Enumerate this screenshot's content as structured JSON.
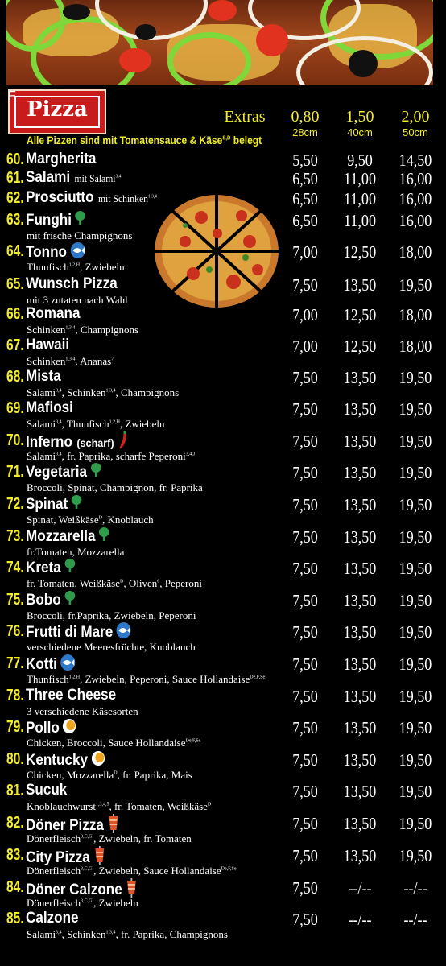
{
  "header": {
    "title": "Pizza",
    "title_sup": "F",
    "extras_label": "Extras",
    "extras": [
      "0,80",
      "1,50",
      "2,00"
    ],
    "sizes": [
      "28cm",
      "40cm",
      "50cm"
    ],
    "note": "Alle Pizzen sind mit Tomatensauce & Käse",
    "note_sup": "S,D",
    "note_end": "belegt"
  },
  "colors": {
    "accent_yellow": "#f2ec2a",
    "badge_red": "#c81c1c",
    "leaf_green": "#3aa24a"
  },
  "items": [
    {
      "num": "60.",
      "name": "Margherita",
      "extra": "",
      "extra_sup": "",
      "icon": "",
      "desc": "",
      "p": [
        "5,50",
        "9,50",
        "14,50"
      ]
    },
    {
      "num": "61.",
      "name": "Salami",
      "extra": "mit Salami",
      "extra_sup": "3,4",
      "icon": "",
      "desc": "",
      "p": [
        "6,50",
        "11,00",
        "16,00"
      ]
    },
    {
      "num": "62.",
      "name": "Prosciutto",
      "extra": "mit Schinken",
      "extra_sup": "1,3,4",
      "icon": "",
      "desc": "",
      "p": [
        "6,50",
        "11,00",
        "16,00"
      ]
    },
    {
      "num": "63.",
      "name": "Funghi",
      "extra": "",
      "extra_sup": "",
      "icon": "leaf-icon",
      "desc": "mit frische Champignons",
      "p": [
        "6,50",
        "11,00",
        "16,00"
      ]
    },
    {
      "num": "64.",
      "name": "Tonno",
      "extra": "",
      "extra_sup": "",
      "icon": "fish-icon",
      "desc": "Thunfisch<sup>1,2,H</sup>, Zwiebeln",
      "p": [
        "7,00",
        "12,50",
        "18,00"
      ]
    },
    {
      "num": "65.",
      "name": "Wunsch  Pizza",
      "extra": "",
      "extra_sup": "",
      "icon": "",
      "desc": "mit 3 zutaten nach Wahl",
      "p": [
        "7,50",
        "13,50",
        "19,50"
      ]
    },
    {
      "num": "66.",
      "name": "Romana",
      "extra": "",
      "extra_sup": "",
      "icon": "",
      "desc": "Schinken<sup>1,3,4</sup>, Champignons",
      "p": [
        "7,00",
        "12,50",
        "18,00"
      ]
    },
    {
      "num": "67.",
      "name": "Hawaii",
      "extra": "",
      "extra_sup": "",
      "icon": "",
      "desc": "Schinken<sup>1,3,4</sup>, Ananas<sup>7</sup>",
      "p": [
        "7,00",
        "12,50",
        "18,00"
      ]
    },
    {
      "num": "68.",
      "name": "Mista",
      "extra": "",
      "extra_sup": "",
      "icon": "",
      "desc": "Salami<sup>3,4</sup>, Schinken<sup>1,3,4</sup>, Champignons",
      "p": [
        "7,50",
        "13,50",
        "19,50"
      ]
    },
    {
      "num": "69.",
      "name": "Mafiosi",
      "extra": "",
      "extra_sup": "",
      "icon": "",
      "desc": "Salami<sup>3,4</sup>, Thunfisch<sup>1,2,H</sup>, Zwiebeln",
      "p": [
        "7,50",
        "13,50",
        "19,50"
      ]
    },
    {
      "num": "70.",
      "name": "Inferno",
      "extra": "(scharf)",
      "extra_sup": "",
      "icon": "chili-icon",
      "desc": "Salami<sup>3,4</sup>, fr. Paprika, scharfe Peperoni<sup>3,4,J</sup>",
      "p": [
        "7,50",
        "13,50",
        "19,50"
      ]
    },
    {
      "num": "71.",
      "name": "Vegetaria",
      "extra": "",
      "extra_sup": "",
      "icon": "leaf-icon",
      "desc": "Broccoli, Spinat, Champignon, fr. Paprika",
      "p": [
        "7,50",
        "13,50",
        "19,50"
      ]
    },
    {
      "num": "72.",
      "name": "Spinat",
      "extra": "",
      "extra_sup": "",
      "icon": "leaf-icon",
      "desc": "Spinat, Weißkäse<sup>D</sup>, Knoblauch",
      "p": [
        "7,50",
        "13,50",
        "19,50"
      ]
    },
    {
      "num": "73.",
      "name": "Mozzarella",
      "extra": "",
      "extra_sup": "",
      "icon": "leaf-icon",
      "desc": "fr.Tomaten, Mozzarella",
      "p": [
        "7,50",
        "13,50",
        "19,50"
      ]
    },
    {
      "num": "74.",
      "name": "Kreta",
      "extra": "",
      "extra_sup": "",
      "icon": "leaf-icon",
      "desc": "fr. Tomaten, Weißkäse<sup>D</sup>, Oliven<sup>6</sup>, Peperoni",
      "p": [
        "7,50",
        "13,50",
        "19,50"
      ]
    },
    {
      "num": "75.",
      "name": "Bobo",
      "extra": "",
      "extra_sup": "",
      "icon": "leaf-icon",
      "desc": "Broccoli, fr.Paprika, Zwiebeln, Peperoni",
      "p": [
        "7,50",
        "13,50",
        "19,50"
      ]
    },
    {
      "num": "76.",
      "name": "Frutti  di  Mare",
      "extra": "",
      "extra_sup": "",
      "icon": "fish-icon",
      "desc": "verschiedene Meeresfrüchte, Knoblauch",
      "p": [
        "7,50",
        "13,50",
        "19,50"
      ]
    },
    {
      "num": "77.",
      "name": "Kotti",
      "extra": "",
      "extra_sup": "",
      "icon": "fish-icon",
      "desc": "Thunfisch<sup>1,2,H</sup>, Zwiebeln, Peperoni, Sauce Hollandaise<sup>De,F,Se</sup>",
      "p": [
        "7,50",
        "13,50",
        "19,50"
      ]
    },
    {
      "num": "78.",
      "name": "Three Cheese",
      "extra": "",
      "extra_sup": "",
      "icon": "",
      "desc": "3 verschiedene Käsesorten",
      "p": [
        "7,50",
        "13,50",
        "19,50"
      ]
    },
    {
      "num": "79.",
      "name": "Pollo",
      "extra": "",
      "extra_sup": "",
      "icon": "chicken-icon",
      "desc": "Chicken, Broccoli, Sauce Hollandaise<sup>De,F,Se</sup>",
      "p": [
        "7,50",
        "13,50",
        "19,50"
      ]
    },
    {
      "num": "80.",
      "name": "Kentucky",
      "extra": "",
      "extra_sup": "",
      "icon": "chicken-icon",
      "desc": "Chicken, Mozzarella<sup>D</sup>, fr. Paprika, Mais",
      "p": [
        "7,50",
        "13,50",
        "19,50"
      ]
    },
    {
      "num": "81.",
      "name": "Sucuk",
      "extra": "",
      "extra_sup": "",
      "icon": "",
      "desc": "Knoblauchwurst<sup>1,3,4,5</sup>, fr. Tomaten, Weißkäse<sup>D</sup>",
      "p": [
        "7,50",
        "13,50",
        "19,50"
      ]
    },
    {
      "num": "82.",
      "name": "Döner  Pizza",
      "extra": "",
      "extra_sup": "",
      "icon": "doner-icon",
      "desc": "Dönerfleisch<sup>3,C,Gl</sup>, Zwiebeln, fr. Tomaten",
      "p": [
        "7,50",
        "13,50",
        "19,50"
      ]
    },
    {
      "num": "83.",
      "name": "City Pizza",
      "extra": "",
      "extra_sup": "",
      "icon": "doner-icon",
      "desc": "Dönerfleisch<sup>3,C,Gl</sup>, Zwiebeln, Sauce Hollandaise<sup>De,F,Se</sup>",
      "p": [
        "7,50",
        "13,50",
        "19,50"
      ]
    },
    {
      "num": "84.",
      "name": "Döner Calzone",
      "extra": "",
      "extra_sup": "",
      "icon": "doner-icon",
      "desc": "Dönerfleisch<sup>3,C,Gl</sup>, Zwiebeln",
      "p": [
        "7,50",
        "--/--",
        "--/--"
      ]
    },
    {
      "num": "85.",
      "name": "Calzone",
      "extra": "",
      "extra_sup": "",
      "icon": "",
      "desc": "Salami<sup>3,4</sup>, Schinken<sup>1,3,4</sup>, fr. Paprika, Champignons",
      "p": [
        "7,50",
        "--/--",
        "--/--"
      ]
    }
  ]
}
